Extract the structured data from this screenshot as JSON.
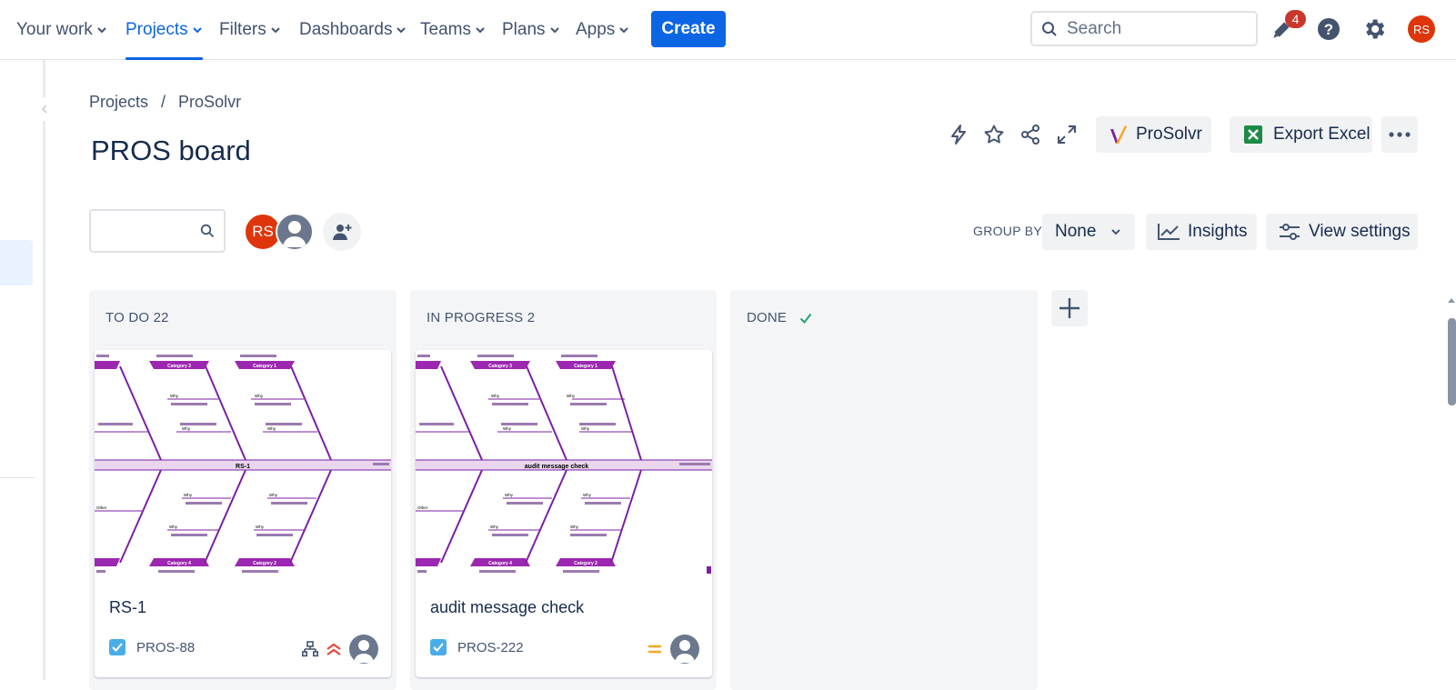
{
  "nav": {
    "items": [
      {
        "label": "Your work"
      },
      {
        "label": "Projects"
      },
      {
        "label": "Filters"
      },
      {
        "label": "Dashboards"
      },
      {
        "label": "Teams"
      },
      {
        "label": "Plans"
      },
      {
        "label": "Apps"
      }
    ],
    "active": "Projects",
    "create_label": "Create",
    "search_placeholder": "Search",
    "notification_count": "4",
    "user_initials": "RS"
  },
  "breadcrumb": [
    "Projects",
    "/",
    "ProSolvr"
  ],
  "page": {
    "title": "PROS board",
    "prosolvr_label": "ProSolvr",
    "export_label": "Export Excel"
  },
  "toolbar": {
    "avatar_initials": "RS",
    "group_by_label": "GROUP BY",
    "group_by_value": "None",
    "insights_label": "Insights",
    "view_settings_label": "View settings"
  },
  "columns": [
    {
      "title": "TO DO 22"
    },
    {
      "title": "IN PROGRESS 2"
    },
    {
      "title": "DONE"
    }
  ],
  "cards": [
    {
      "summary": "RS-1",
      "key": "PROS-88",
      "priority": "high",
      "cover": {
        "center": "RS-1",
        "categories": [
          "Category 1",
          "Category 3",
          "Category 4",
          "Category 2"
        ],
        "why": "Why",
        "other": "Other"
      }
    },
    {
      "summary": "audit message check",
      "key": "PROS-222",
      "priority": "medium",
      "cover": {
        "center": "audit message check",
        "categories": [
          "Category 1",
          "Category 3",
          "Category 4",
          "Category 2"
        ],
        "why": "Why",
        "other": "Other"
      }
    }
  ],
  "colors": {
    "accent": "#0c66e4",
    "fishbone": "#7b1fa2",
    "avatar": "#de350b",
    "done_check": "#22a06b",
    "priority_high": "#e2483d",
    "priority_medium": "#f5a623"
  }
}
